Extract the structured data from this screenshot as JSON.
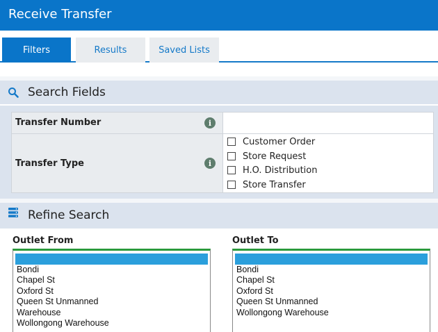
{
  "header": {
    "title": "Receive Transfer"
  },
  "tabs": [
    {
      "label": "Filters",
      "active": true
    },
    {
      "label": "Results",
      "active": false
    },
    {
      "label": "Saved Lists",
      "active": false
    }
  ],
  "search_fields": {
    "heading": "Search Fields",
    "icon": "search-icon",
    "transfer_number": {
      "label": "Transfer Number",
      "value": ""
    },
    "transfer_type": {
      "label": "Transfer Type",
      "options": [
        "Customer Order",
        "Store Request",
        "H.O. Distribution",
        "Store Transfer"
      ]
    }
  },
  "refine_search": {
    "heading": "Refine Search",
    "icon": "server-stack-icon",
    "outlet_from": {
      "label": "Outlet From",
      "options": [
        "",
        "Bondi",
        "Chapel St",
        "Oxford St",
        "Queen St Unmanned",
        "Warehouse",
        "Wollongong Warehouse"
      ]
    },
    "outlet_to": {
      "label": "Outlet To",
      "options": [
        "",
        "Bondi",
        "Chapel St",
        "Oxford St",
        "Queen St Unmanned",
        "Wollongong Warehouse"
      ]
    }
  },
  "colors": {
    "primary": "#0a75c9",
    "section_bg": "#dbe3ee",
    "list_accent": "#2b9a3c",
    "selection": "#2b9fdc"
  }
}
